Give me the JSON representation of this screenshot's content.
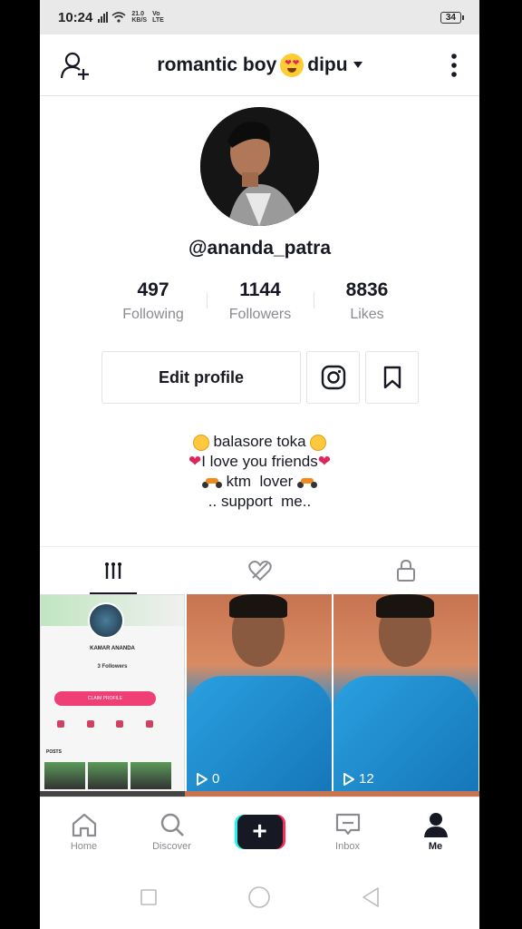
{
  "status_bar": {
    "time": "10:24",
    "speed_value": "21.0",
    "speed_unit": "KB/S",
    "carrier_top": "Vo",
    "carrier_bottom": "LTE",
    "battery": "34"
  },
  "header": {
    "name_prefix": "romantic boy",
    "name_suffix": "dipu",
    "emoji_icon": "heart-eyes-emoji"
  },
  "profile": {
    "username": "@ananda_patra",
    "stats": [
      {
        "value": "497",
        "label": "Following"
      },
      {
        "value": "1144",
        "label": "Followers"
      },
      {
        "value": "8836",
        "label": "Likes"
      }
    ],
    "edit_label": "Edit profile",
    "bio": {
      "line1": "balasore toka",
      "line2": "I love you friends",
      "line3": "ktm  lover",
      "line4": ".. support  me.."
    }
  },
  "tabs": [
    {
      "icon": "grid-icon",
      "active": true
    },
    {
      "icon": "liked-heart-icon",
      "active": false
    },
    {
      "icon": "lock-icon",
      "active": false
    }
  ],
  "videos": [
    {
      "type": "profile-screenshot",
      "mini": {
        "name": "KAMAR ANANDA",
        "followers": "3 Followers",
        "button": "CLAIM PROFILE",
        "section": "POSTS"
      }
    },
    {
      "type": "photo",
      "views": "0"
    },
    {
      "type": "photo",
      "views": "12"
    }
  ],
  "bottom_nav": {
    "home": "Home",
    "discover": "Discover",
    "create": "+",
    "inbox": "Inbox",
    "me": "Me"
  },
  "colors": {
    "text_primary": "#161823",
    "text_secondary": "#8a8b91",
    "create_cyan": "#25f4ee",
    "create_red": "#fe2c55"
  }
}
